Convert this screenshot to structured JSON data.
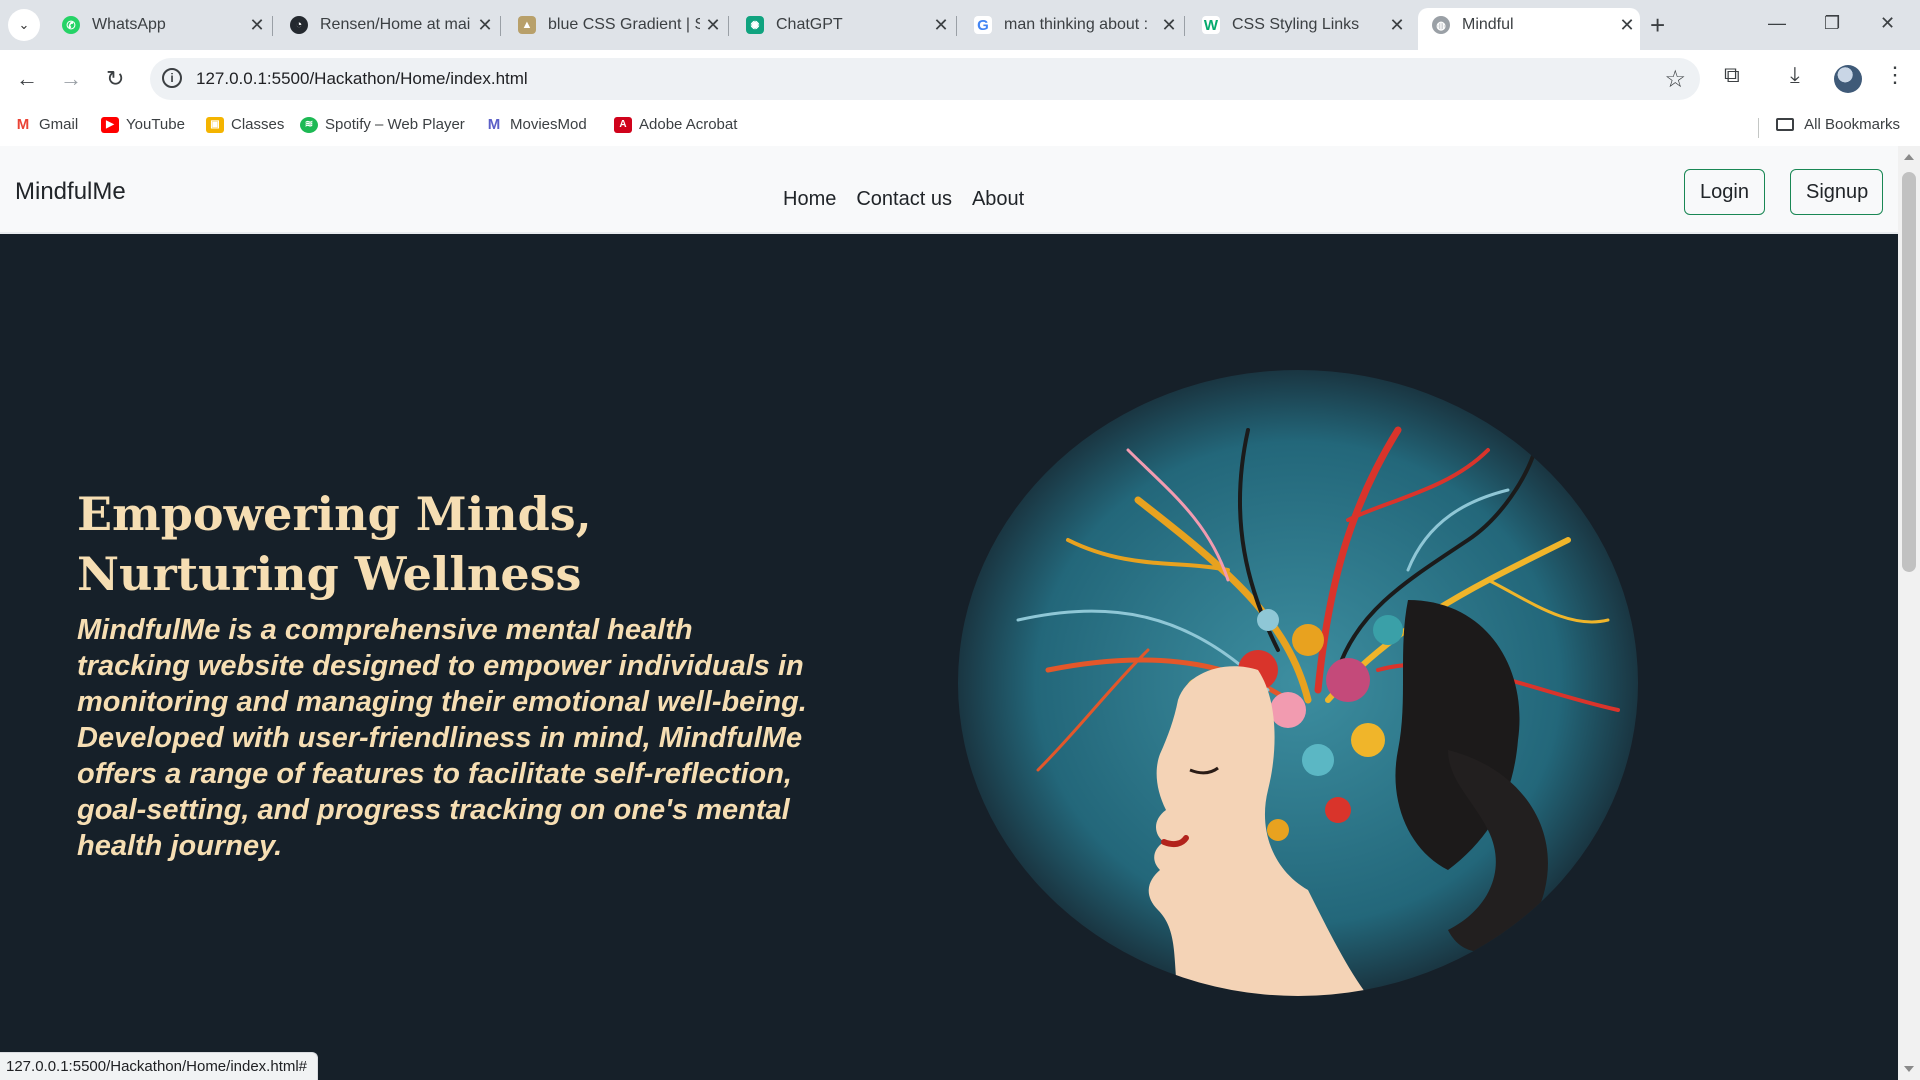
{
  "browser": {
    "tabs": [
      {
        "title": "WhatsApp",
        "icon": "whatsapp-icon",
        "color": "#25d366"
      },
      {
        "title": "Rensen/Home at mai",
        "icon": "github-icon",
        "color": "#24292f"
      },
      {
        "title": "blue CSS Gradient | S",
        "icon": "cssgradient-icon",
        "color": "#7a6a3a"
      },
      {
        "title": "ChatGPT",
        "icon": "chatgpt-icon",
        "color": "#10a37f"
      },
      {
        "title": "man thinking about :",
        "icon": "google-icon",
        "color": "#4285f4"
      },
      {
        "title": "CSS Styling Links",
        "icon": "w3schools-icon",
        "color": "#04aa6d"
      },
      {
        "title": "Mindful",
        "icon": "globe-icon",
        "color": "#9aa0a6"
      }
    ],
    "address": "127.0.0.1:5500/Hackathon/Home/index.html",
    "bookmarks": [
      {
        "label": "Gmail",
        "color": "#ea4335"
      },
      {
        "label": "YouTube",
        "color": "#ff0000"
      },
      {
        "label": "Classes",
        "color": "#f4b400"
      },
      {
        "label": "Spotify – Web Player",
        "color": "#1db954"
      },
      {
        "label": "MoviesMod",
        "color": "#5b5fc7"
      },
      {
        "label": "Adobe Acrobat",
        "color": "#d0021b"
      }
    ],
    "all_bookmarks": "All Bookmarks",
    "status_url": "127.0.0.1:5500/Hackathon/Home/index.html#"
  },
  "site": {
    "brand": "MindfulMe",
    "nav": [
      "Home",
      "Contact us",
      "About"
    ],
    "login": "Login",
    "signup": "Signup",
    "hero_title": "Empowering Minds, Nurturing Wellness",
    "hero_text": "MindfulMe is a comprehensive mental health tracking website designed to empower individuals in monitoring and managing their emotional well-being. Developed with user-friendliness in mind, MindfulMe offers a range of features to facilitate self-reflection, goal-setting, and progress tracking on one's mental health journey.",
    "colors": {
      "hero_bg": "#162029",
      "hero_text": "#f6deb3",
      "button_border": "#198754"
    }
  }
}
